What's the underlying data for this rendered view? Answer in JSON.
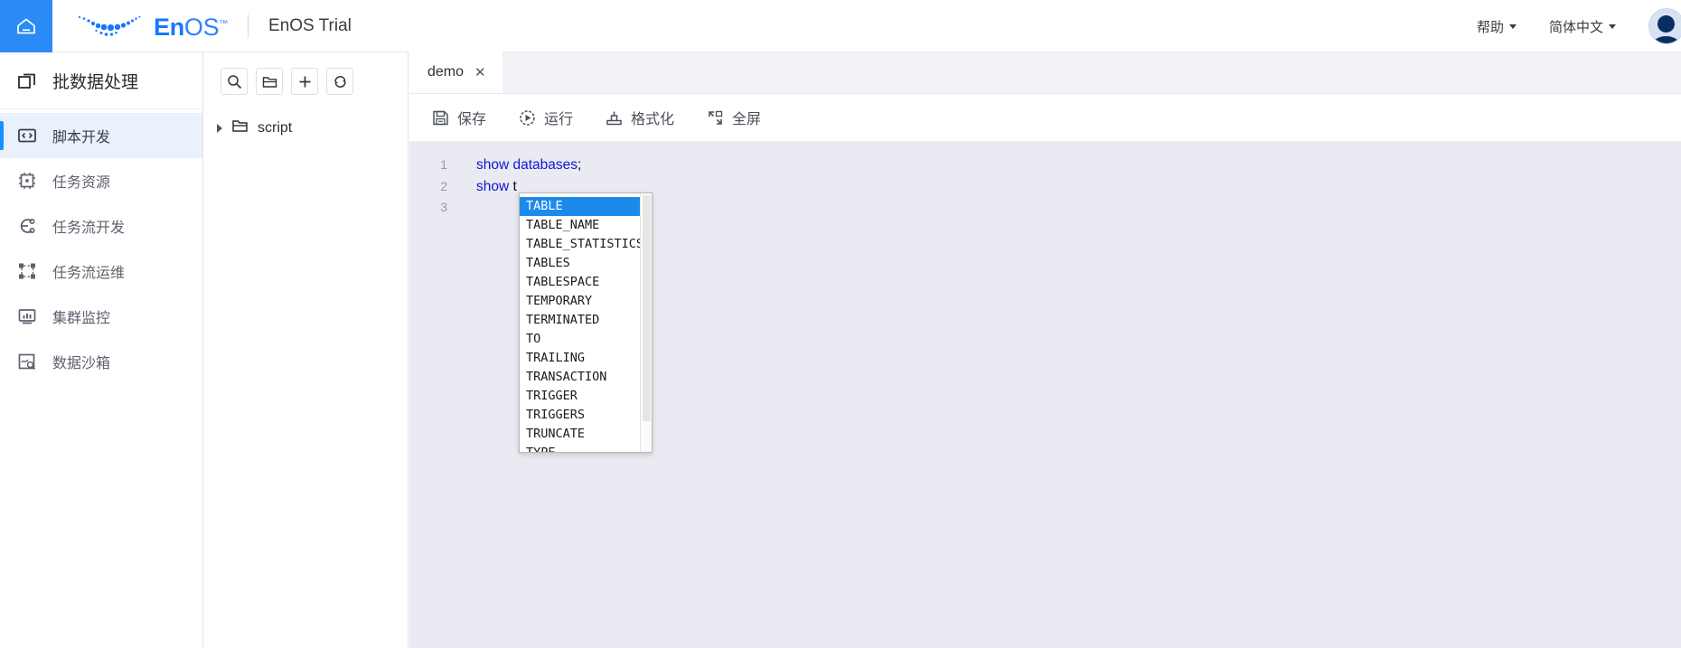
{
  "header": {
    "home_icon": "home-icon",
    "logo_en": "En",
    "logo_os": "OS",
    "logo_tm": "™",
    "product_name": "EnOS Trial",
    "help_label": "帮助",
    "language_label": "简体中文",
    "avatar_icon": "user-avatar"
  },
  "sidebar": {
    "title": "批数据处理",
    "title_icon": "batch-data-icon",
    "items": [
      {
        "label": "脚本开发",
        "icon": "code-brackets-icon",
        "active": true
      },
      {
        "label": "任务资源",
        "icon": "chip-icon",
        "active": false
      },
      {
        "label": "任务流开发",
        "icon": "flow-icon",
        "active": false
      },
      {
        "label": "任务流运维",
        "icon": "nodes-icon",
        "active": false
      },
      {
        "label": "集群监控",
        "icon": "monitor-icon",
        "active": false
      },
      {
        "label": "数据沙箱",
        "icon": "sandbox-icon",
        "active": false
      }
    ]
  },
  "file_panel": {
    "toolbar": [
      {
        "icon": "search-icon",
        "name": "search-button"
      },
      {
        "icon": "new-folder-icon",
        "name": "new-folder-button"
      },
      {
        "icon": "plus-icon",
        "name": "add-button"
      },
      {
        "icon": "refresh-icon",
        "name": "refresh-button"
      }
    ],
    "tree": [
      {
        "label": "script",
        "icon": "folder-icon",
        "expanded": false
      }
    ]
  },
  "editor": {
    "tabs": [
      {
        "label": "demo",
        "close": "✕",
        "active": true
      }
    ],
    "toolbar": [
      {
        "label": "保存",
        "icon": "save-icon"
      },
      {
        "label": "运行",
        "icon": "run-icon"
      },
      {
        "label": "格式化",
        "icon": "format-icon"
      },
      {
        "label": "全屏",
        "icon": "fullscreen-icon"
      }
    ],
    "code": [
      {
        "num": "1",
        "tokens": [
          {
            "t": "show databases",
            "c": "kw"
          },
          {
            "t": ";",
            "c": "plain"
          }
        ]
      },
      {
        "num": "2",
        "tokens": [
          {
            "t": "show ",
            "c": "kw"
          },
          {
            "t": "t",
            "c": "plain"
          }
        ]
      },
      {
        "num": "3",
        "tokens": []
      }
    ],
    "autocomplete": {
      "selected_index": 0,
      "items": [
        "TABLE",
        "TABLE_NAME",
        "TABLE_STATISTICS",
        "TABLES",
        "TABLESPACE",
        "TEMPORARY",
        "TERMINATED",
        "TO",
        "TRAILING",
        "TRANSACTION",
        "TRIGGER",
        "TRIGGERS",
        "TRUNCATE",
        "TYPE"
      ]
    }
  },
  "colors": {
    "accent": "#1890ff",
    "home_blue": "#2a8af6",
    "select_blue": "#1c8aeb",
    "code_keyword": "#1414d6",
    "editor_bg": "#e9eaf2"
  }
}
